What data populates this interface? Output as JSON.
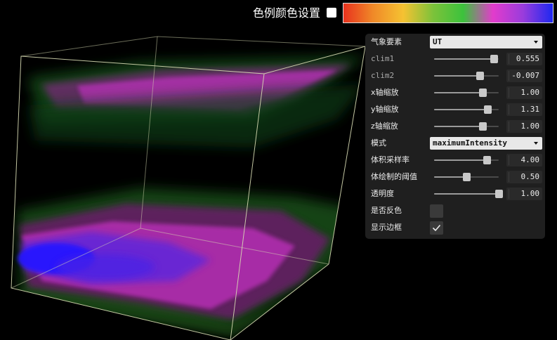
{
  "colorbar": {
    "label": "色例颜色设置",
    "checkbox_checked": false,
    "gradient_stops": [
      "#e8321e",
      "#f08a28",
      "#f5c232",
      "#7cc23a",
      "#3cc23c",
      "#e23ccc",
      "#9a3cdc",
      "#1e28f0"
    ]
  },
  "gui": {
    "variable": {
      "label": "气象要素",
      "value": "UT"
    },
    "clim1": {
      "label": "clim1",
      "value": "0.555",
      "position": 0.92
    },
    "clim2": {
      "label": "clim2",
      "value": "-0.007",
      "position": 0.71
    },
    "xscale": {
      "label": "x轴缩放",
      "value": "1.00",
      "position": 0.75
    },
    "yscale": {
      "label": "y轴缩放",
      "value": "1.31",
      "position": 0.83
    },
    "zscale": {
      "label": "z轴缩放",
      "value": "1.00",
      "position": 0.75
    },
    "mode": {
      "label": "模式",
      "value": "maximumIntensity"
    },
    "sample_rate": {
      "label": "体积采样率",
      "value": "4.00",
      "position": 0.81
    },
    "threshold": {
      "label": "体绘制的阈值",
      "value": "0.50",
      "position": 0.5
    },
    "opacity": {
      "label": "透明度",
      "value": "1.00",
      "position": 1.0
    },
    "invert": {
      "label": "是否反色",
      "checked": false
    },
    "show_border": {
      "label": "显示边框",
      "checked": true
    }
  },
  "colors": {
    "panel_bg": "#1f1f1f",
    "box_edge": "#d8dcb4",
    "volume_green": "#1e6420",
    "volume_magenta": "#b432b4",
    "volume_blue": "#2818ff"
  }
}
